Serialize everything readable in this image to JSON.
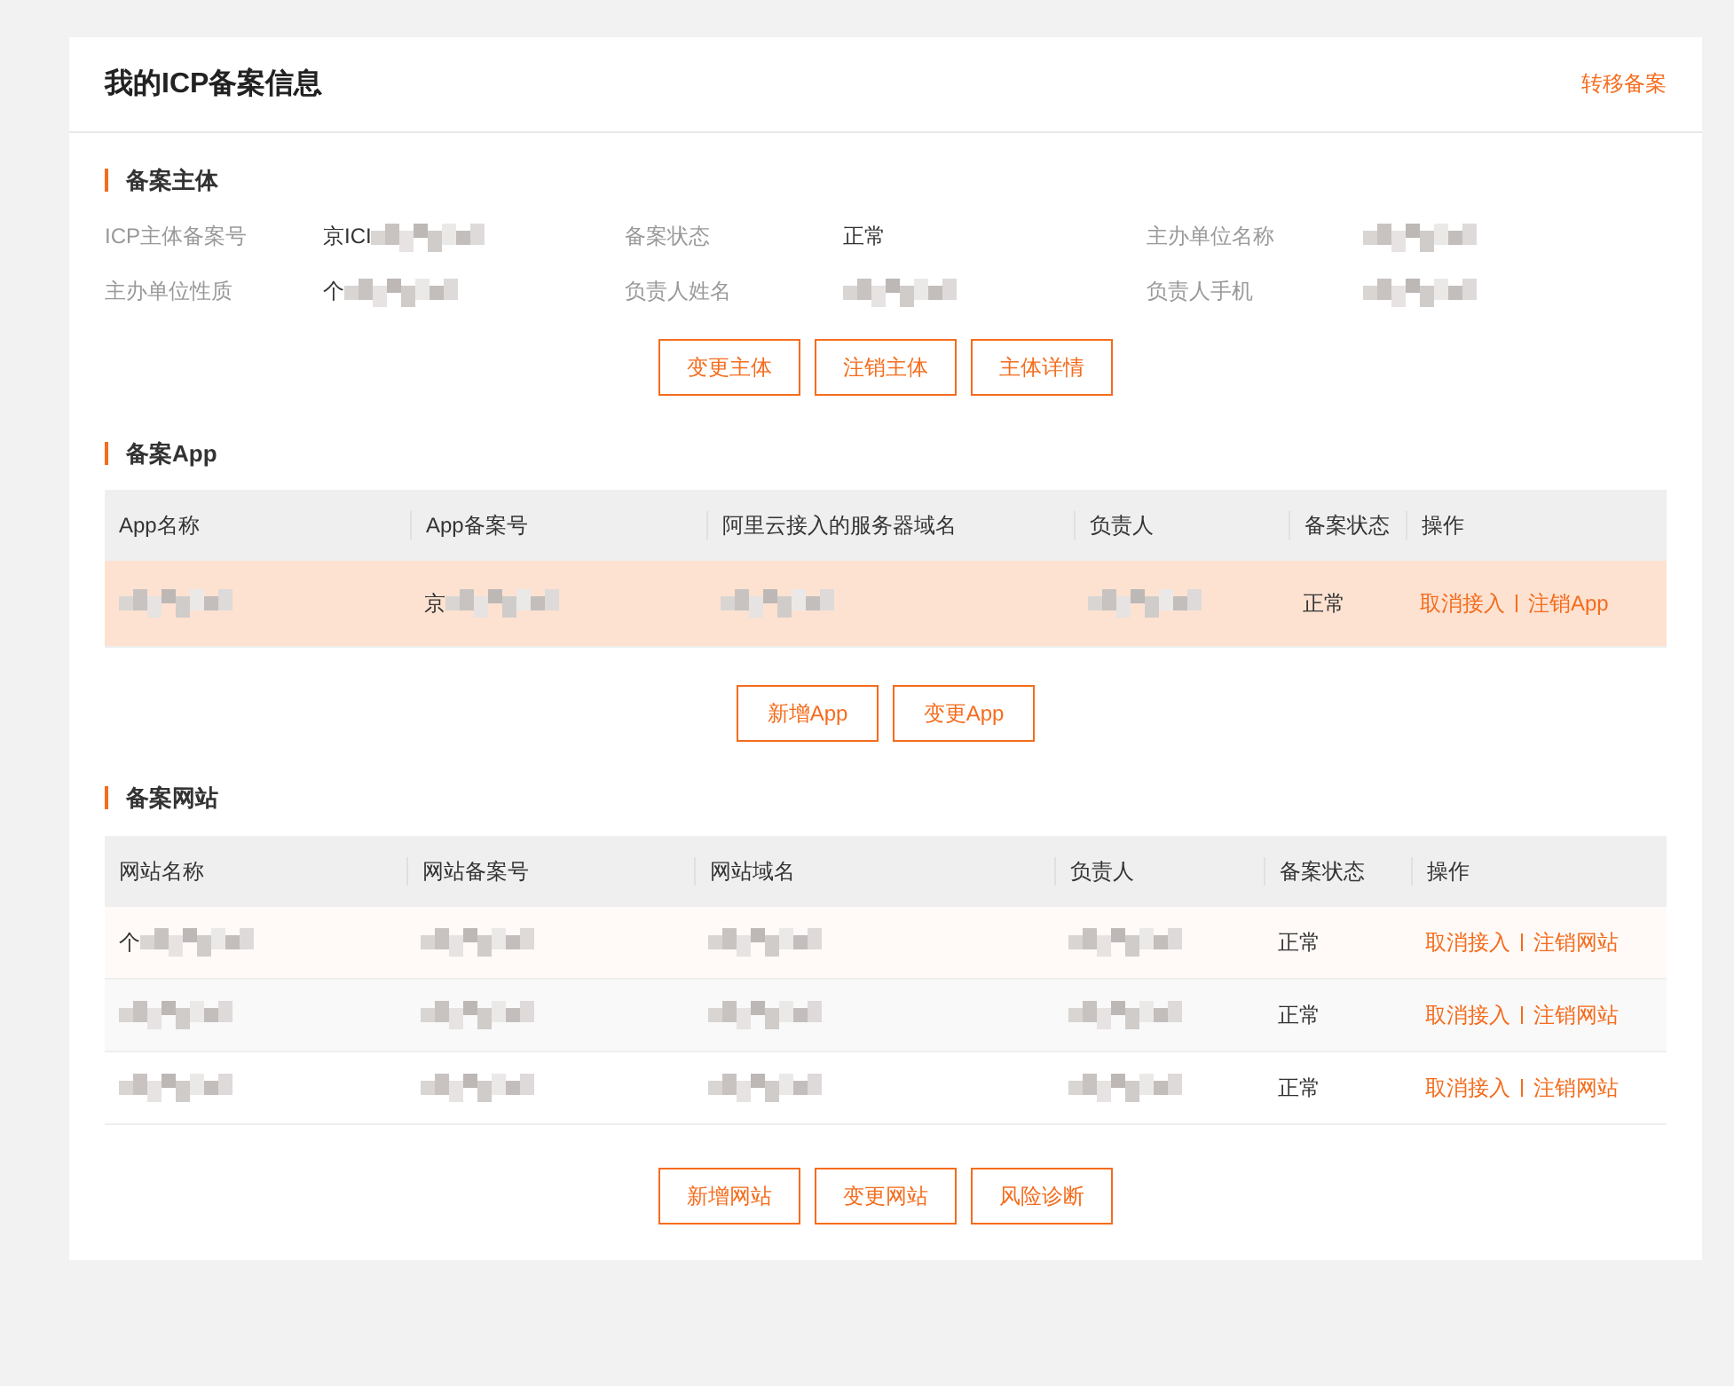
{
  "header": {
    "title": "我的ICP备案信息",
    "action": "转移备案"
  },
  "subject": {
    "title": "备案主体",
    "fields": [
      {
        "label": "ICP主体备案号",
        "text": "京ICI",
        "redacted": true
      },
      {
        "label": "备案状态",
        "text": "正常",
        "redacted": false
      },
      {
        "label": "主办单位名称",
        "redacted": true
      },
      {
        "label": "主办单位性质",
        "text": "个",
        "redacted": true
      },
      {
        "label": "负责人姓名",
        "redacted": true
      },
      {
        "label": "负责人手机",
        "redacted": true
      }
    ],
    "buttons": [
      "变更主体",
      "注销主体",
      "主体详情"
    ]
  },
  "apps": {
    "title": "备案App",
    "columns": [
      "App名称",
      "App备案号",
      "阿里云接入的服务器域名",
      "负责人",
      "备案状态",
      "操作"
    ],
    "rows": [
      {
        "kind": "selected",
        "cells": [
          {
            "redacted": true
          },
          {
            "text": "京",
            "redacted": true
          },
          {
            "redacted": true
          },
          {
            "redacted": true
          },
          {
            "text": "正常",
            "redacted": false
          }
        ],
        "actions": [
          "取消接入",
          "注销App"
        ]
      }
    ],
    "buttons": [
      "新增App",
      "变更App"
    ]
  },
  "sites": {
    "title": "备案网站",
    "columns": [
      "网站名称",
      "网站备案号",
      "网站域名",
      "负责人",
      "备案状态",
      "操作"
    ],
    "rows": [
      {
        "kind": "hover",
        "cells": [
          {
            "text": "个",
            "redacted": true
          },
          {
            "redacted": true
          },
          {
            "redacted": true
          },
          {
            "redacted": true
          },
          {
            "text": "正常",
            "redacted": false
          }
        ],
        "actions": [
          "取消接入",
          "注销网站"
        ]
      },
      {
        "kind": "striped",
        "cells": [
          {
            "redacted": true
          },
          {
            "redacted": true
          },
          {
            "redacted": true
          },
          {
            "redacted": true
          },
          {
            "text": "正常",
            "redacted": false
          }
        ],
        "actions": [
          "取消接入",
          "注销网站"
        ]
      },
      {
        "kind": "plain",
        "cells": [
          {
            "redacted": true
          },
          {
            "redacted": true
          },
          {
            "redacted": true
          },
          {
            "redacted": true
          },
          {
            "text": "正常",
            "redacted": false
          }
        ],
        "actions": [
          "取消接入",
          "注销网站"
        ]
      }
    ],
    "buttons": [
      "新增网站",
      "变更网站",
      "风险诊断"
    ]
  }
}
